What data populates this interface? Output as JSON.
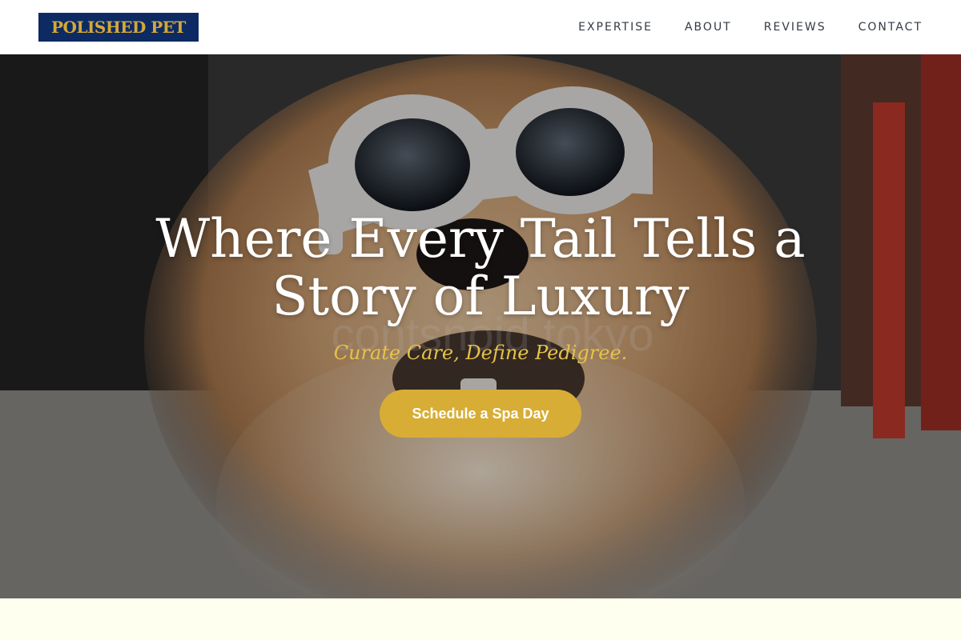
{
  "header": {
    "logo_text": "POLISHED PET",
    "nav": [
      "EXPERTISE",
      "ABOUT",
      "REVIEWS",
      "CONTACT"
    ]
  },
  "hero": {
    "headline": "Where Every Tail Tells a Story of Luxury",
    "tagline": "Curate Care, Define Pedigree.",
    "cta_label": "Schedule a Spa Day",
    "image_watermark": "contsnoid tokyo"
  },
  "colors": {
    "brand_navy": "#0d2a63",
    "brand_gold": "#d8ad35",
    "tagline_gold": "#e6c24a",
    "page_background": "#fffff0"
  },
  "icons": [
    "dog-photo",
    "sunglasses"
  ]
}
